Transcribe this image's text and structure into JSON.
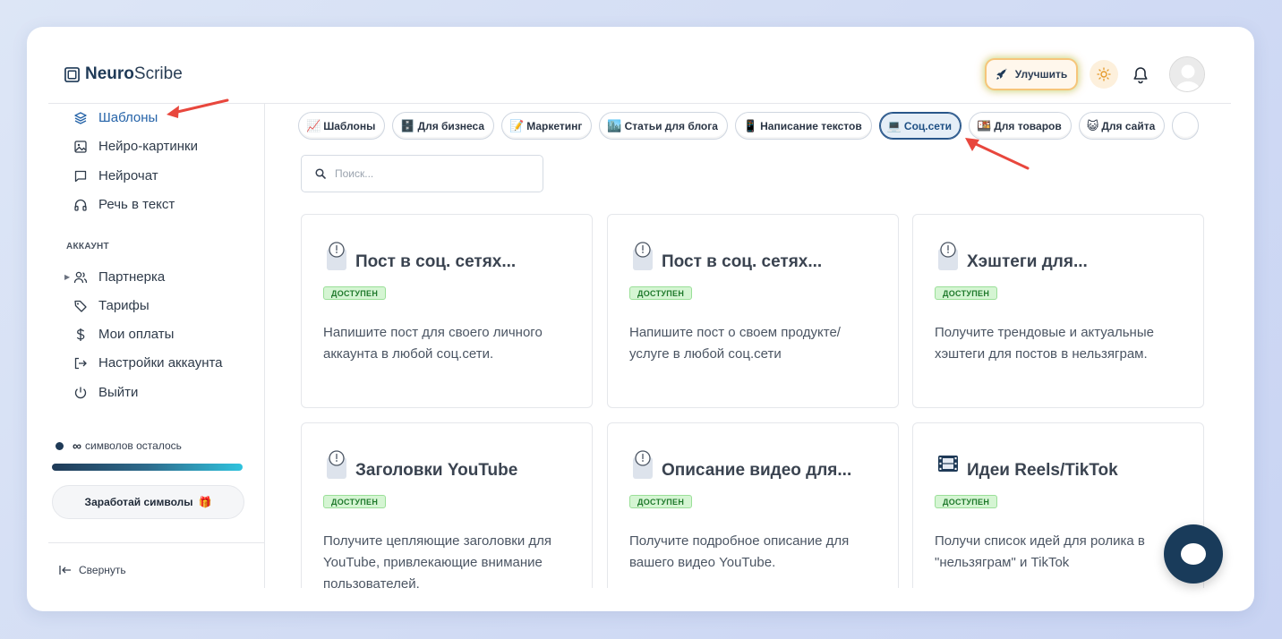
{
  "header": {
    "logo_bold": "Neuro",
    "logo_light": "Scribe",
    "upgrade_label": "Улучшить",
    "icons": [
      "rocket-icon",
      "sun-icon",
      "bell-icon",
      "avatar"
    ]
  },
  "sidebar": {
    "nav": [
      {
        "label": "Шаблоны",
        "icon": "layers-icon",
        "active": true
      },
      {
        "label": "Нейро-картинки",
        "icon": "image-icon"
      },
      {
        "label": "Нейрочат",
        "icon": "chat-icon"
      },
      {
        "label": "Речь в текст",
        "icon": "headphones-icon"
      }
    ],
    "section_label": "АККАУНТ",
    "account": [
      {
        "label": "Партнерка",
        "icon": "users-icon"
      },
      {
        "label": "Тарифы",
        "icon": "tag-icon"
      },
      {
        "label": "Мои оплаты",
        "icon": "dollar-icon"
      },
      {
        "label": "Настройки аккаунта",
        "icon": "logout-icon"
      },
      {
        "label": "Выйти",
        "icon": "power-icon"
      }
    ],
    "symbols_infinity": "∞",
    "symbols_text": "символов осталось",
    "symbols_progress": 1.0,
    "earn_label": "Заработай символы",
    "earn_emoji": "🎁",
    "collapse_label": "Свернуть"
  },
  "main": {
    "chips": [
      {
        "emoji": "📈",
        "label": "Шаблоны"
      },
      {
        "emoji": "🗄️",
        "label": "Для бизнеса"
      },
      {
        "emoji": "📝",
        "label": "Маркетинг"
      },
      {
        "emoji": "🏙️",
        "label": "Статьи для блога"
      },
      {
        "emoji": "📱",
        "label": "Написание текстов"
      },
      {
        "emoji": "💻",
        "label": "Соц.сети",
        "active": true
      },
      {
        "emoji": "🍱",
        "label": "Для товаров"
      },
      {
        "emoji": "😺",
        "label": "Для сайта"
      }
    ],
    "search_placeholder": "Поиск...",
    "cards": [
      {
        "title": "Пост в соц. сетях...",
        "badge": "ДОСТУПЕН",
        "desc": "Напишите пост для своего личного аккаунта в любой соц.сети.",
        "icon": "clock-icon"
      },
      {
        "title": "Пост в соц. сетях...",
        "badge": "ДОСТУПЕН",
        "desc": "Напишите пост о своем продукте/ услуге в любой соц.сети",
        "icon": "clock-icon"
      },
      {
        "title": "Хэштеги для...",
        "badge": "ДОСТУПЕН",
        "desc": "Получите трендовые и актуальные хэштеги для постов в нельзяграм.",
        "icon": "clock-icon"
      },
      {
        "title": "Заголовки YouTube",
        "badge": "ДОСТУПЕН",
        "desc": "Получите цепляющие заголовки для YouTube, привлекающие внимание пользователей.",
        "icon": "clock-icon"
      },
      {
        "title": "Описание видео для...",
        "badge": "ДОСТУПЕН",
        "desc": "Получите подробное описание для вашего видео YouTube.",
        "icon": "clock-icon"
      },
      {
        "title": "Идеи Reels/TikTok",
        "badge": "ДОСТУПЕН",
        "desc": "Получи список идей для ролика в \"нельзяграм\" и TikTok",
        "icon": "film-icon"
      }
    ]
  },
  "colors": {
    "accent": "#2563a8",
    "dark": "#193b5a",
    "badge_bg": "#d5f5d3",
    "arrow": "#e8473d"
  }
}
